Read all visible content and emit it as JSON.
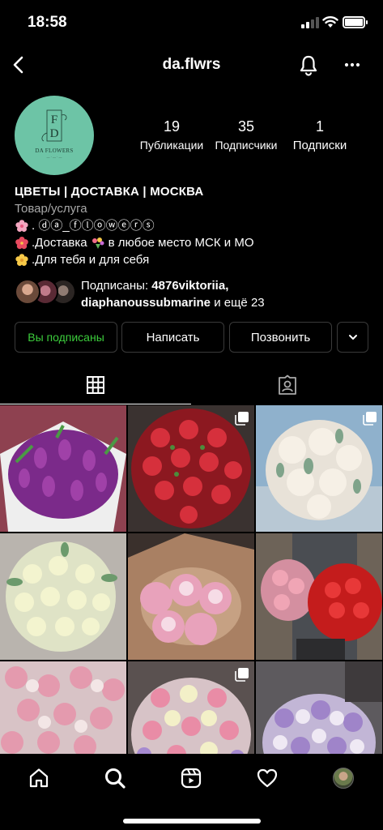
{
  "status_bar": {
    "time": "18:58"
  },
  "header": {
    "username": "da.flwrs"
  },
  "profile": {
    "avatar_mono": "FD",
    "avatar_text": "DA FLOWERS",
    "stats": [
      {
        "value": "19",
        "label": "Публикации"
      },
      {
        "value": "35",
        "label": "Подписчики"
      },
      {
        "value": "1",
        "label": "Подписки"
      }
    ]
  },
  "bio": {
    "name": "ЦВЕТЫ | ДОСТАВКА | МОСКВА",
    "category": "Товар/услуга",
    "line1": ". ⓓⓐ_ⓕⓛⓞⓦⓔⓡⓢ",
    "line2_pre": ".Доставка",
    "line2_post": "в любое место МСК и МО",
    "line3": ".Для тебя и для себя"
  },
  "followed_by": {
    "prefix": "Подписаны: ",
    "user1": "4876viktoriia,",
    "user2": "diaphanoussubmarine",
    "suffix": " и ещё 23"
  },
  "actions": {
    "following": "Вы подписаны",
    "message": "Написать",
    "call": "Позвонить"
  },
  "icons": [
    "back-icon",
    "bell-icon",
    "more-icon",
    "grid-icon",
    "tagged-icon",
    "home-icon",
    "search-icon",
    "reels-icon",
    "heart-icon",
    "profile-avatar"
  ],
  "colors": {
    "following_green": "#3ccd3c",
    "avatar_bg": "#6dc4a6"
  }
}
